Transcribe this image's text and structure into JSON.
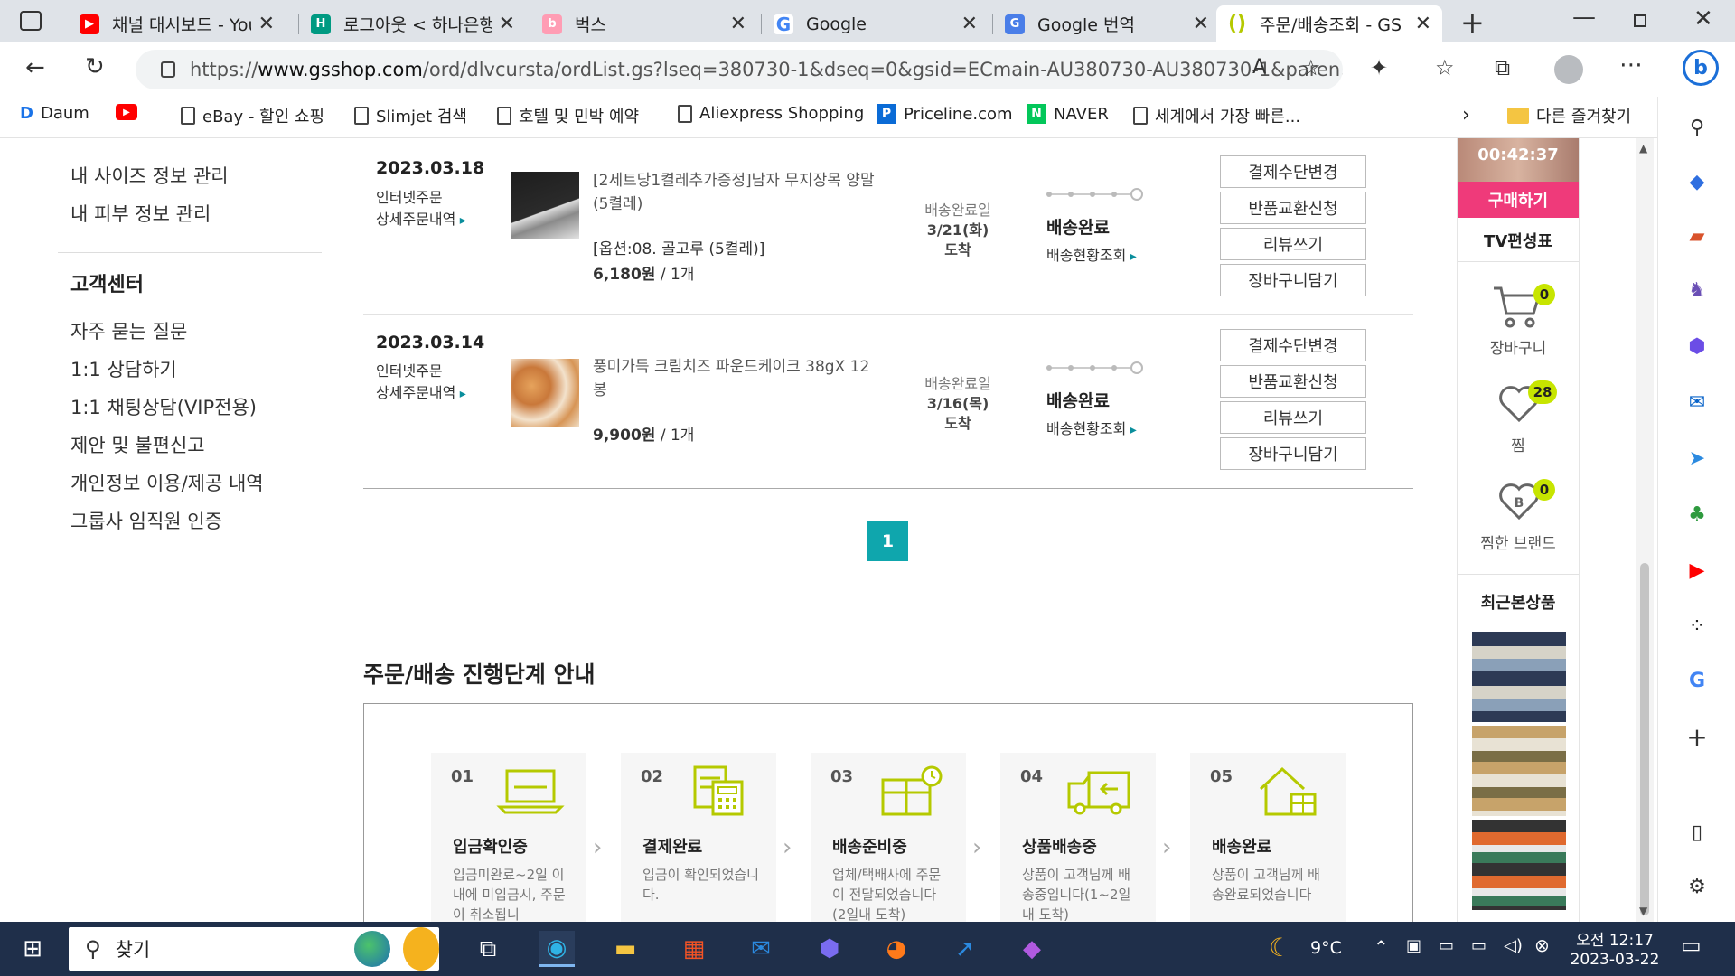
{
  "browser": {
    "tabs": [
      {
        "title": "채널 대시보드 - You",
        "icon": "youtube-icon",
        "color": "#ff0000"
      },
      {
        "title": "로그아웃 < 하나은행",
        "icon": "hana-bank-icon",
        "color": "#009a82"
      },
      {
        "title": "벅스",
        "icon": "bugs-icon",
        "color": "#ff5a7a"
      },
      {
        "title": "Google",
        "icon": "google-icon",
        "color": "#4285f4"
      },
      {
        "title": "Google 번역",
        "icon": "google-translate-icon",
        "color": "#4a7ee8"
      },
      {
        "title": "주문/배송조회 - GS",
        "icon": "gsshop-icon",
        "color": "#c7d800"
      }
    ],
    "url_prefix": "https://",
    "url_domain": "www.gsshop.com",
    "url_path": "/ord/dlvcursta/ordList.gs?lseq=380730-1&dseq=0&gsid=ECmain-AU380730-AU380730-1&paren...",
    "bookmarks": [
      {
        "label": "Daum",
        "icon": "daum-icon"
      },
      {
        "label": "",
        "icon": "youtube-icon"
      },
      {
        "label": "eBay - 할인 쇼핑",
        "icon": "page-icon"
      },
      {
        "label": "Slimjet 검색",
        "icon": "page-icon"
      },
      {
        "label": "호텔 및 민박 예약",
        "icon": "page-icon"
      },
      {
        "label": "Aliexpress Shopping",
        "icon": "page-icon"
      },
      {
        "label": "Priceline.com",
        "icon": "priceline-icon"
      },
      {
        "label": "NAVER",
        "icon": "naver-icon"
      },
      {
        "label": "세계에서 가장 빠른...",
        "icon": "page-icon"
      }
    ],
    "other_favorites": "다른 즐겨찾기"
  },
  "sidebar": {
    "links": [
      "내 사이즈 정보 관리",
      "내 피부 정보 관리"
    ],
    "section_title": "고객센터",
    "cs_links": [
      "자주 묻는 질문",
      "1:1 상담하기",
      "1:1 채팅상담(VIP전용)",
      "제안 및 불편신고",
      "개인정보 이용/제공 내역",
      "그룹사 임직원 인증"
    ]
  },
  "orders": [
    {
      "date": "2023.03.18",
      "type": "인터넷주문",
      "detail_link": "상세주문내역",
      "product_name": "[2세트당1켤레추가증정]남자 무지장목 양말 (5켤레)",
      "option": "[옵션:08. 골고루 (5켤레)]",
      "price": "6,180",
      "price_unit": "원",
      "qty": " / 1개",
      "delivery_label": "배송완료일",
      "delivery_date": "3/21(화)",
      "delivery_arrive": "도착",
      "status": "배송완료",
      "tracking": "배송현황조회",
      "buttons": [
        "결제수단변경",
        "반품교환신청",
        "리뷰쓰기",
        "장바구니담기"
      ]
    },
    {
      "date": "2023.03.14",
      "type": "인터넷주문",
      "detail_link": "상세주문내역",
      "product_name": "풍미가득 크림치즈 파운드케이크 38gX 12봉",
      "option": "",
      "price": "9,900",
      "price_unit": "원",
      "qty": " / 1개",
      "delivery_label": "배송완료일",
      "delivery_date": "3/16(목)",
      "delivery_arrive": "도착",
      "status": "배송완료",
      "tracking": "배송현황조회",
      "buttons": [
        "결제수단변경",
        "반품교환신청",
        "리뷰쓰기",
        "장바구니담기"
      ]
    }
  ],
  "pagination": {
    "current": "1"
  },
  "guide": {
    "title": "주문/배송 진행단계 안내",
    "steps": [
      {
        "num": "01",
        "name": "입금확인중",
        "desc": "입금미완료~2일 이내에 미입금시, 주문이 취소됩니",
        "icon": "laptop-icon"
      },
      {
        "num": "02",
        "name": "결제완료",
        "desc": "입금이 확인되었습니다.",
        "icon": "calculator-icon"
      },
      {
        "num": "03",
        "name": "배송준비중",
        "desc": "업체/택배사에 주문이 전달되었습니다(2일내 도착)",
        "icon": "gift-box-icon"
      },
      {
        "num": "04",
        "name": "상품배송중",
        "desc": "상품이 고객님께 배송중입니다(1~2일내 도착)",
        "icon": "truck-icon"
      },
      {
        "num": "05",
        "name": "배송완료",
        "desc": "상품이 고객님께 배송완료되었습니다",
        "icon": "house-icon"
      }
    ]
  },
  "right_panel": {
    "timer": "00:42:37",
    "buy_button": "구매하기",
    "tv_schedule": "TV편성표",
    "cart_label": "장바구니",
    "cart_count": "0",
    "wish_label": "찜",
    "wish_count": "28",
    "brand_label": "찜한 브랜드",
    "brand_count": "0",
    "recent_title": "최근본상품"
  },
  "taskbar": {
    "search_placeholder": "찾기",
    "weather": "9°C",
    "time_ampm": "오전 12:17",
    "date": "2023-03-22"
  },
  "colors": {
    "accent": "#0fa6ad",
    "buy": "#ef3a7a",
    "badge": "#c7e500",
    "icon_green": "#b5c900"
  }
}
